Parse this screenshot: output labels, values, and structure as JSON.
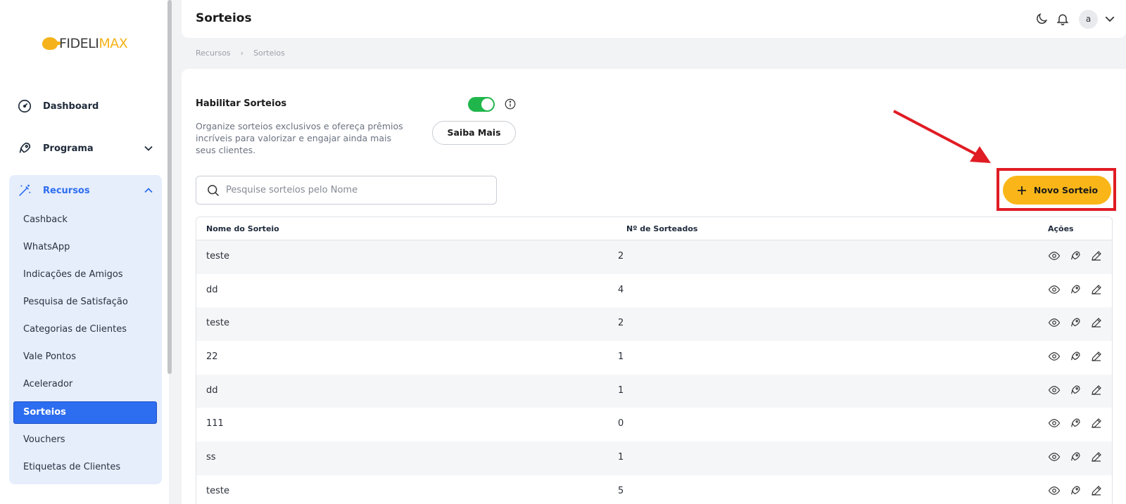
{
  "app": {
    "logo_part1": "FIDELI",
    "logo_part2": "MAX",
    "brand_color": "#fab619",
    "accent_color": "#2d6df0"
  },
  "sidebar": {
    "items": [
      {
        "label": "Dashboard",
        "icon": "gauge-icon"
      },
      {
        "label": "Programa",
        "icon": "rocket-icon"
      },
      {
        "label": "Recursos",
        "icon": "magic-wand-icon"
      }
    ],
    "sub_items": [
      "Cashback",
      "WhatsApp",
      "Indicações de Amigos",
      "Pesquisa de Satisfação",
      "Categorias de Clientes",
      "Vale Pontos",
      "Acelerador",
      "Sorteios",
      "Vouchers",
      "Etiquetas de Clientes"
    ],
    "active_sub_item": "Sorteios"
  },
  "header": {
    "title": "Sorteios",
    "avatar_initial": "a"
  },
  "breadcrumb": [
    "Recursos",
    "Sorteios"
  ],
  "settings": {
    "enable_label": "Habilitar Sorteios",
    "enabled": true,
    "description": "Organize sorteios exclusivos e ofereça prêmios incríveis para valorizar e engajar ainda mais seus clientes.",
    "learn_more_label": "Saiba Mais"
  },
  "search": {
    "placeholder": "Pesquise sorteios pelo Nome",
    "value": ""
  },
  "new_button_label": "Novo Sorteio",
  "table": {
    "columns": [
      "Nome do Sorteio",
      "Nº de Sorteados",
      "Ações"
    ],
    "rows": [
      {
        "name": "teste",
        "count": "2"
      },
      {
        "name": "dd",
        "count": "4"
      },
      {
        "name": "teste",
        "count": "2"
      },
      {
        "name": "22",
        "count": "1"
      },
      {
        "name": "dd",
        "count": "1"
      },
      {
        "name": "111",
        "count": "0"
      },
      {
        "name": "ss",
        "count": "1"
      },
      {
        "name": "teste",
        "count": "5"
      }
    ],
    "row_actions": [
      "eye-icon",
      "rocket-icon",
      "pencil-icon"
    ]
  }
}
